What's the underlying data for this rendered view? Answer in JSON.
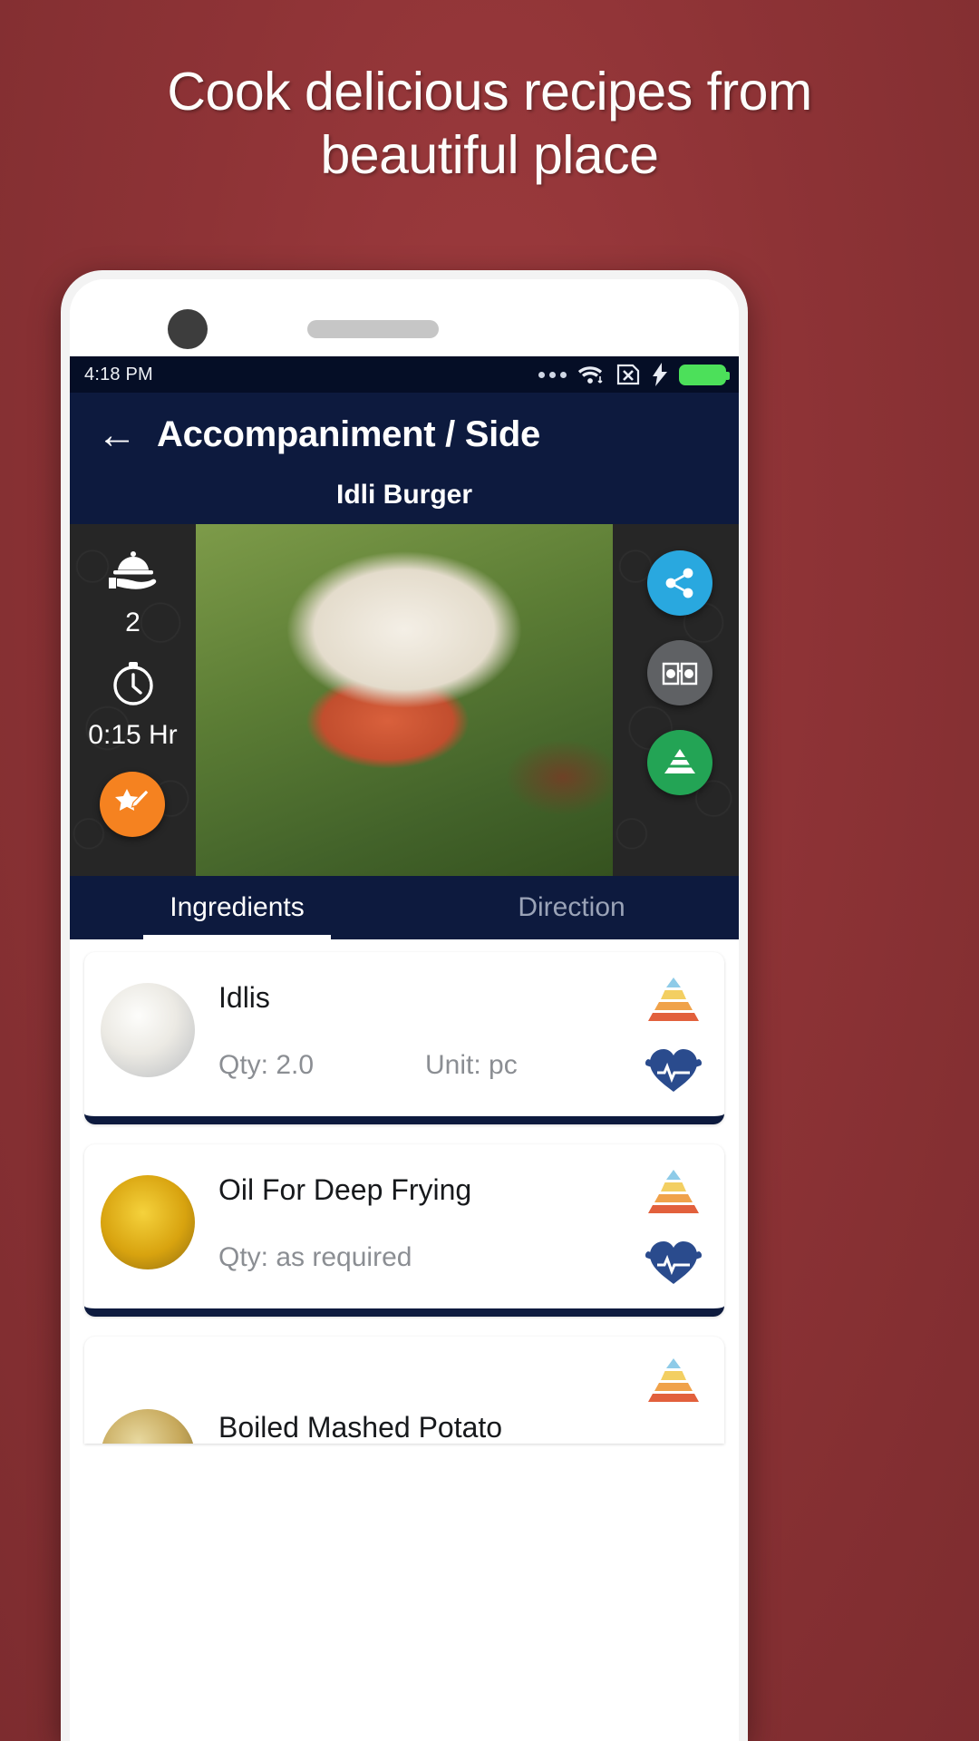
{
  "promo": {
    "headline": "Cook delicious recipes from\nbeautiful place"
  },
  "phone": {
    "statusbar": {
      "time": "4:18 PM",
      "icons": [
        "more-dots-icon",
        "wifi-icon",
        "no-sim-icon",
        "charging-bolt-icon",
        "battery-icon"
      ]
    },
    "appbar": {
      "back_label": "←",
      "title": "Accompaniment / Side"
    },
    "recipe": {
      "name": "Idli Burger",
      "servings_icon": "serving-dome-icon",
      "servings": "2",
      "time_icon": "clock-icon",
      "time": "0:15 Hr",
      "favorite_icon": "star-edit-icon",
      "actions": [
        {
          "name": "share-button",
          "icon": "share-icon",
          "color": "#29a8df"
        },
        {
          "name": "read-button",
          "icon": "book-glasses-icon",
          "color": "#5f6164"
        },
        {
          "name": "pyramid-button",
          "icon": "food-pyramid-icon",
          "color": "#23a455"
        }
      ]
    },
    "tabs": [
      {
        "label": "Ingredients",
        "active": true
      },
      {
        "label": "Direction",
        "active": false
      }
    ],
    "labels": {
      "qty": "Qty:",
      "unit": "Unit:"
    },
    "ingredients": [
      {
        "name": "Idlis",
        "qty": "2.0",
        "unit": "pc",
        "thumb": "idli",
        "show_unit": true,
        "pyramid_icon": "food-pyramid-icon",
        "nutrition_icon": "muscle-heart-icon"
      },
      {
        "name": "Oil For Deep Frying",
        "qty": "as required",
        "unit": "",
        "thumb": "oil",
        "show_unit": false,
        "pyramid_icon": "food-pyramid-icon",
        "nutrition_icon": "muscle-heart-icon"
      },
      {
        "name": "Boiled Mashed Potato",
        "qty": "",
        "unit": "",
        "thumb": "potato",
        "show_unit": false,
        "pyramid_icon": "food-pyramid-icon",
        "nutrition_icon": "muscle-heart-icon"
      }
    ]
  },
  "colors": {
    "background": "#8e3336",
    "appbar": "#0d1a3e",
    "statusbar": "#050e26",
    "accent_orange": "#f58220",
    "accent_blue": "#29a8df",
    "accent_green": "#23a455",
    "accent_gray": "#5f6164",
    "battery_green": "#4ce05a"
  }
}
